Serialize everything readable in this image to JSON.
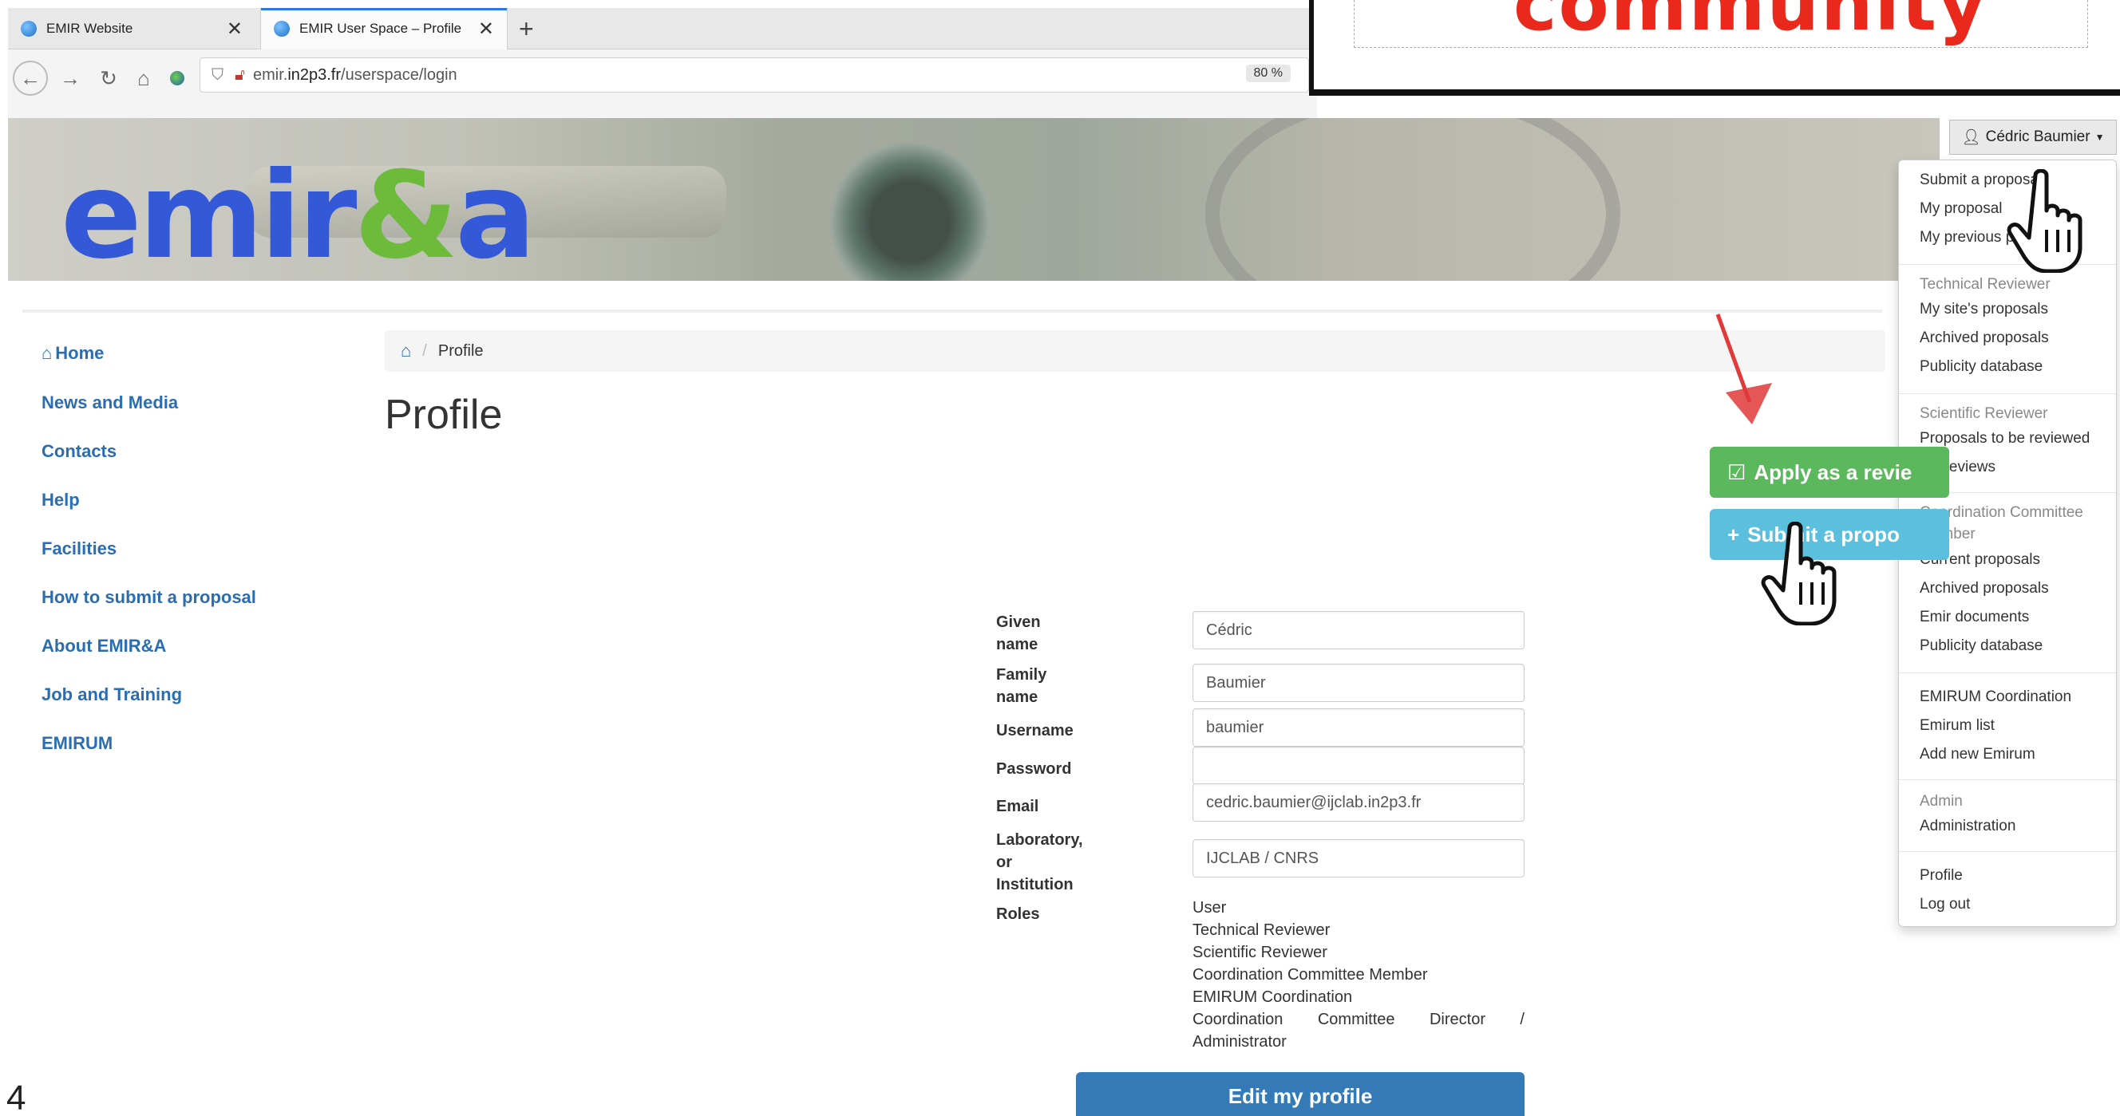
{
  "browser": {
    "tabs": [
      {
        "label": "EMIR Website",
        "active": false
      },
      {
        "label": "EMIR User Space – Profile",
        "active": true
      }
    ],
    "url_prefix": "emir.",
    "url_domain": "in2p3.fr",
    "url_path": "/userspace/login",
    "zoom": "80 %"
  },
  "annotation": {
    "text": "community"
  },
  "logo": {
    "part1": "emir",
    "amp": "&",
    "part2": "a"
  },
  "user_menu": {
    "label": "Cédric Baumier",
    "items_user": [
      "Submit a proposal",
      "My proposal",
      "My previous proposals"
    ],
    "technical_header": "Technical Reviewer",
    "technical_items": [
      "My site's proposals",
      "Archived proposals",
      "Publicity database"
    ],
    "scientific_header": "Scientific Reviewer",
    "scientific_items": [
      "Proposals to be reviewed",
      "My reviews"
    ],
    "coordination_header": "Coordination Committee Member",
    "coordination_items": [
      "Current proposals",
      "Archived proposals",
      "Emir documents",
      "Publicity database"
    ],
    "emirum_items": [
      "EMIRUM Coordination",
      "Emirum list",
      "Add new Emirum"
    ],
    "admin_header": "Admin",
    "admin_items": [
      "Administration"
    ],
    "account_items": [
      "Profile",
      "Log out"
    ]
  },
  "sidebar": {
    "items": [
      "Home",
      "News and Media",
      "Contacts",
      "Help",
      "Facilities",
      "How to submit a proposal",
      "About EMIR&A",
      "Job and Training",
      "EMIRUM"
    ]
  },
  "breadcrumb": {
    "current": "Profile"
  },
  "page_title": "Profile",
  "actions": {
    "apply_label": "Apply as a revie",
    "submit_label": "Submit a propo"
  },
  "form": {
    "given_name_label_1": "Given",
    "given_name_label_2": "name",
    "given_name": "Cédric",
    "family_name_label_1": "Family",
    "family_name_label_2": "name",
    "family_name": "Baumier",
    "username_label": "Username",
    "username": "baumier",
    "password_label": "Password",
    "password": "",
    "email_label": "Email",
    "email": "cedric.baumier@ijclab.in2p3.fr",
    "lab_label_1": "Laboratory,",
    "lab_label_2": "or",
    "lab_label_3": "Institution",
    "lab": "IJCLAB /  CNRS",
    "roles_label": "Roles",
    "roles": [
      "User",
      "Technical Reviewer",
      "Scientific Reviewer",
      "Coordination Committee Member",
      "EMIRUM Coordination"
    ],
    "roles_last_words": [
      "Coordination",
      "Committee",
      "Director",
      "/"
    ],
    "roles_tail": "Administrator"
  },
  "edit_button": "Edit my profile",
  "page_number": "4"
}
